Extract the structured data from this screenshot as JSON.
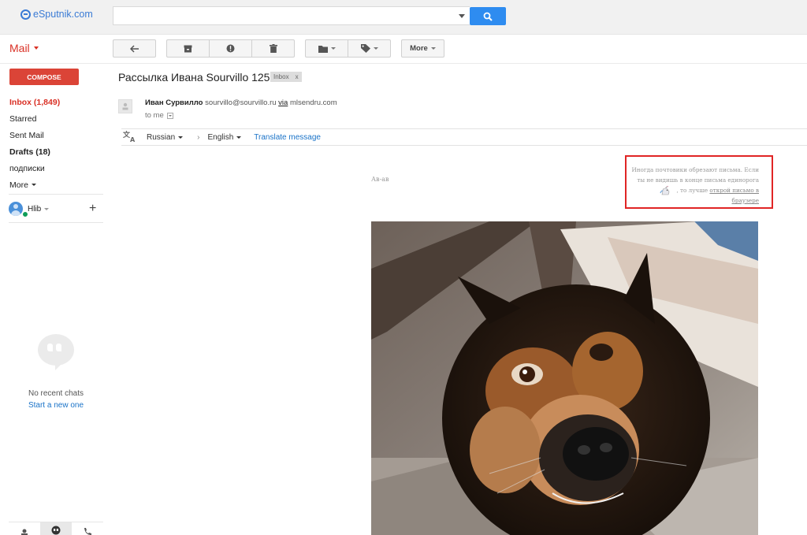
{
  "app": {
    "logo_text": "eSputnik.com"
  },
  "search": {
    "value": "",
    "placeholder": ""
  },
  "header": {
    "mail_label": "Mail"
  },
  "toolbar": {
    "more_label": "More"
  },
  "sidebar": {
    "compose_label": "COMPOSE",
    "items": [
      {
        "label": "Inbox (1,849)",
        "state": "active"
      },
      {
        "label": "Starred",
        "state": "normal"
      },
      {
        "label": "Sent Mail",
        "state": "normal"
      },
      {
        "label": "Drafts (18)",
        "state": "bold"
      },
      {
        "label": "подписки",
        "state": "normal"
      },
      {
        "label": "More",
        "state": "normal"
      }
    ],
    "user_name": "Hlib",
    "no_chats": "No recent chats",
    "start_new": "Start a new one"
  },
  "message": {
    "subject": "Рассылка Ивана Sourvillo 125",
    "tag_label": "Inbox",
    "tag_close": "x",
    "sender_name": "Иван Сурвилло",
    "sender_email": "sourvillo@sourvillo.ru",
    "via_label": "via",
    "via_domain": "mlsendru.com",
    "to_label": "to me"
  },
  "translate": {
    "from_lang": "Russian",
    "to_lang": "English",
    "action": "Translate message"
  },
  "email_body": {
    "greeting": "Ав-ав",
    "notice_line1": "Иногда почтовики обрезают письма. Если",
    "notice_line2": "ты не видишь в конце письма единорога",
    "notice_line3_prefix": ", то лучше",
    "notice_link": "открой письмо в браузере"
  },
  "colors": {
    "accent_red": "#db4437",
    "link_blue": "#1a73c8",
    "search_blue": "#2e8cf0",
    "highlight_box": "#e02525"
  }
}
